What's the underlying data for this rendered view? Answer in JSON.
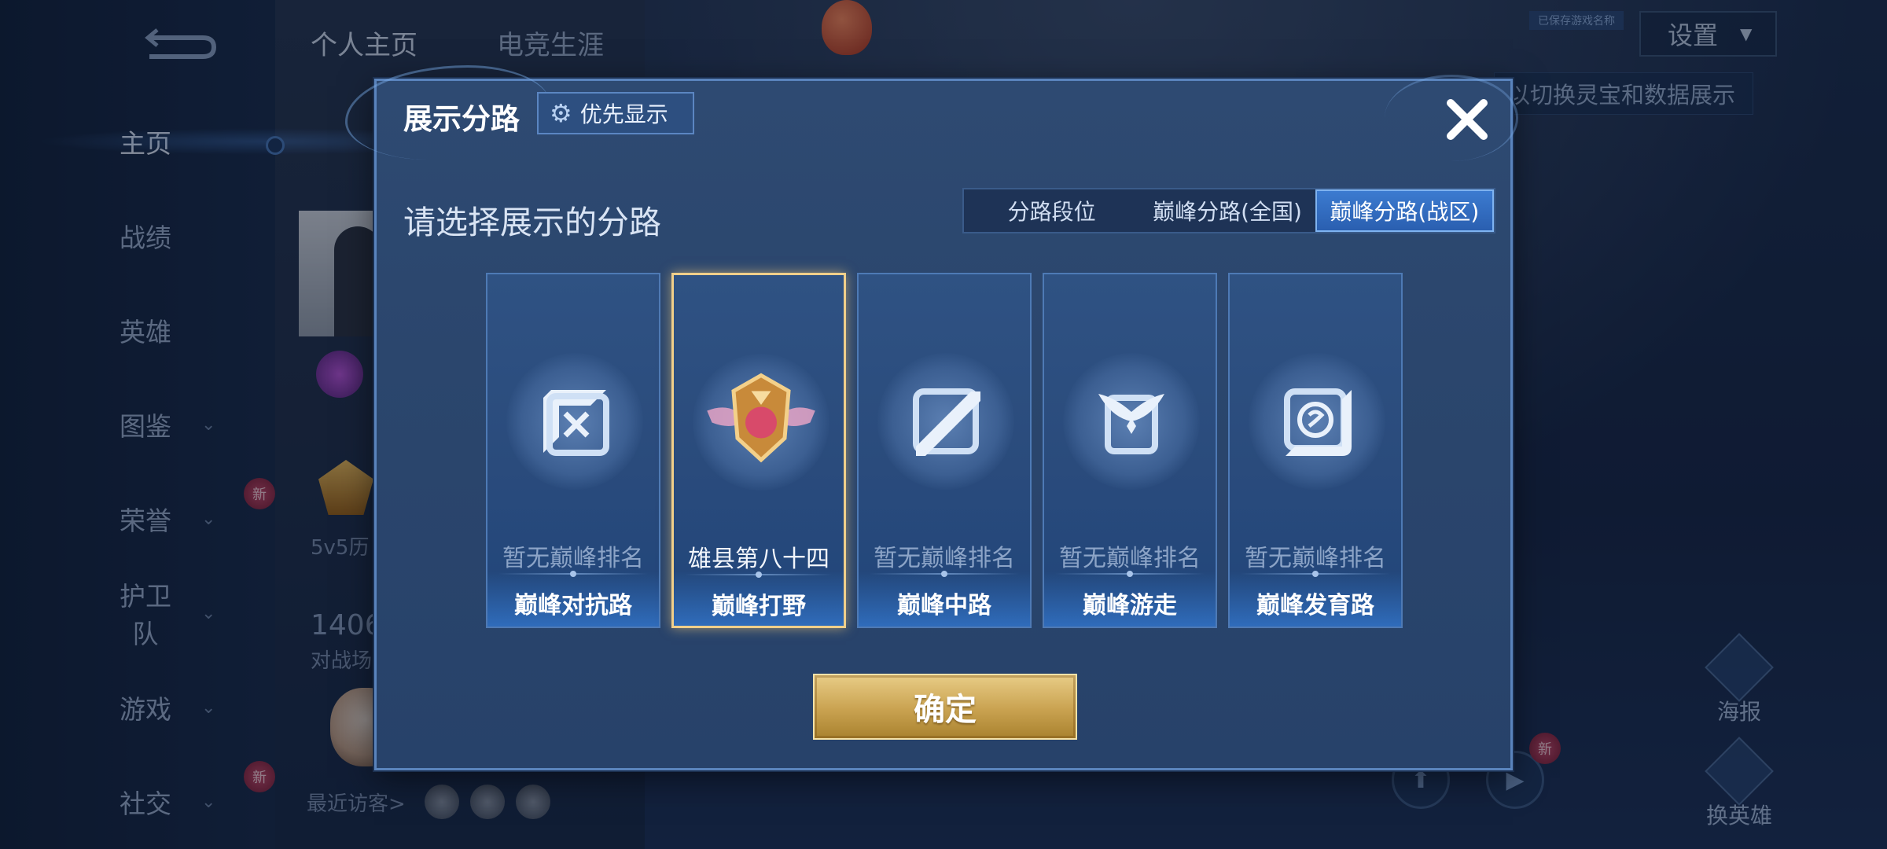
{
  "sidebar": {
    "items": [
      {
        "label": "主页",
        "has_chevron": false
      },
      {
        "label": "战绩",
        "has_chevron": false
      },
      {
        "label": "英雄",
        "has_chevron": false
      },
      {
        "label": "图鉴",
        "has_chevron": true
      },
      {
        "label": "荣誉",
        "has_chevron": true,
        "badge": "新"
      },
      {
        "label": "护卫队",
        "has_chevron": true
      },
      {
        "label": "游戏",
        "has_chevron": true
      },
      {
        "label": "社交",
        "has_chevron": true,
        "badge": "新"
      }
    ],
    "active_index": 0
  },
  "header": {
    "tabs": [
      "个人主页",
      "电竞生涯"
    ],
    "active_tab": 0,
    "settings_label": "设置",
    "top_tag": "已保存游戏名称",
    "hint_text": "以切换灵宝和数据展示"
  },
  "profile": {
    "mode_text": "5v5历",
    "count_text": "1406",
    "count_caption": "对战场",
    "visitors_label": "最近访客>"
  },
  "right_actions": [
    {
      "label": "海报",
      "icon": "poster-icon"
    },
    {
      "label": "换英雄",
      "icon": "swap-hero-icon"
    }
  ],
  "new_badge_text": "新",
  "dialog": {
    "title": "展示分路",
    "priority_button": "优先显示",
    "section_label": "请选择展示的分路",
    "segments": [
      "分路段位",
      "巅峰分路(全国)",
      "巅峰分路(战区)"
    ],
    "active_segment": 2,
    "cards": [
      {
        "status": "暂无巅峰排名",
        "name": "巅峰对抗路",
        "icon": "clash-lane-icon",
        "selected": false
      },
      {
        "status": "雄县第八十四",
        "name": "巅峰打野",
        "icon": "jungle-rank-emblem",
        "selected": true
      },
      {
        "status": "暂无巅峰排名",
        "name": "巅峰中路",
        "icon": "mid-lane-icon",
        "selected": false
      },
      {
        "status": "暂无巅峰排名",
        "name": "巅峰游走",
        "icon": "roam-icon",
        "selected": false
      },
      {
        "status": "暂无巅峰排名",
        "name": "巅峰发育路",
        "icon": "farm-lane-icon",
        "selected": false
      }
    ],
    "confirm_label": "确定"
  },
  "colors": {
    "dialog_bg": "#2b466d",
    "accent_blue": "#3c7bd0",
    "gold": "#c9a250",
    "selected_border": "#f0cf8a"
  }
}
